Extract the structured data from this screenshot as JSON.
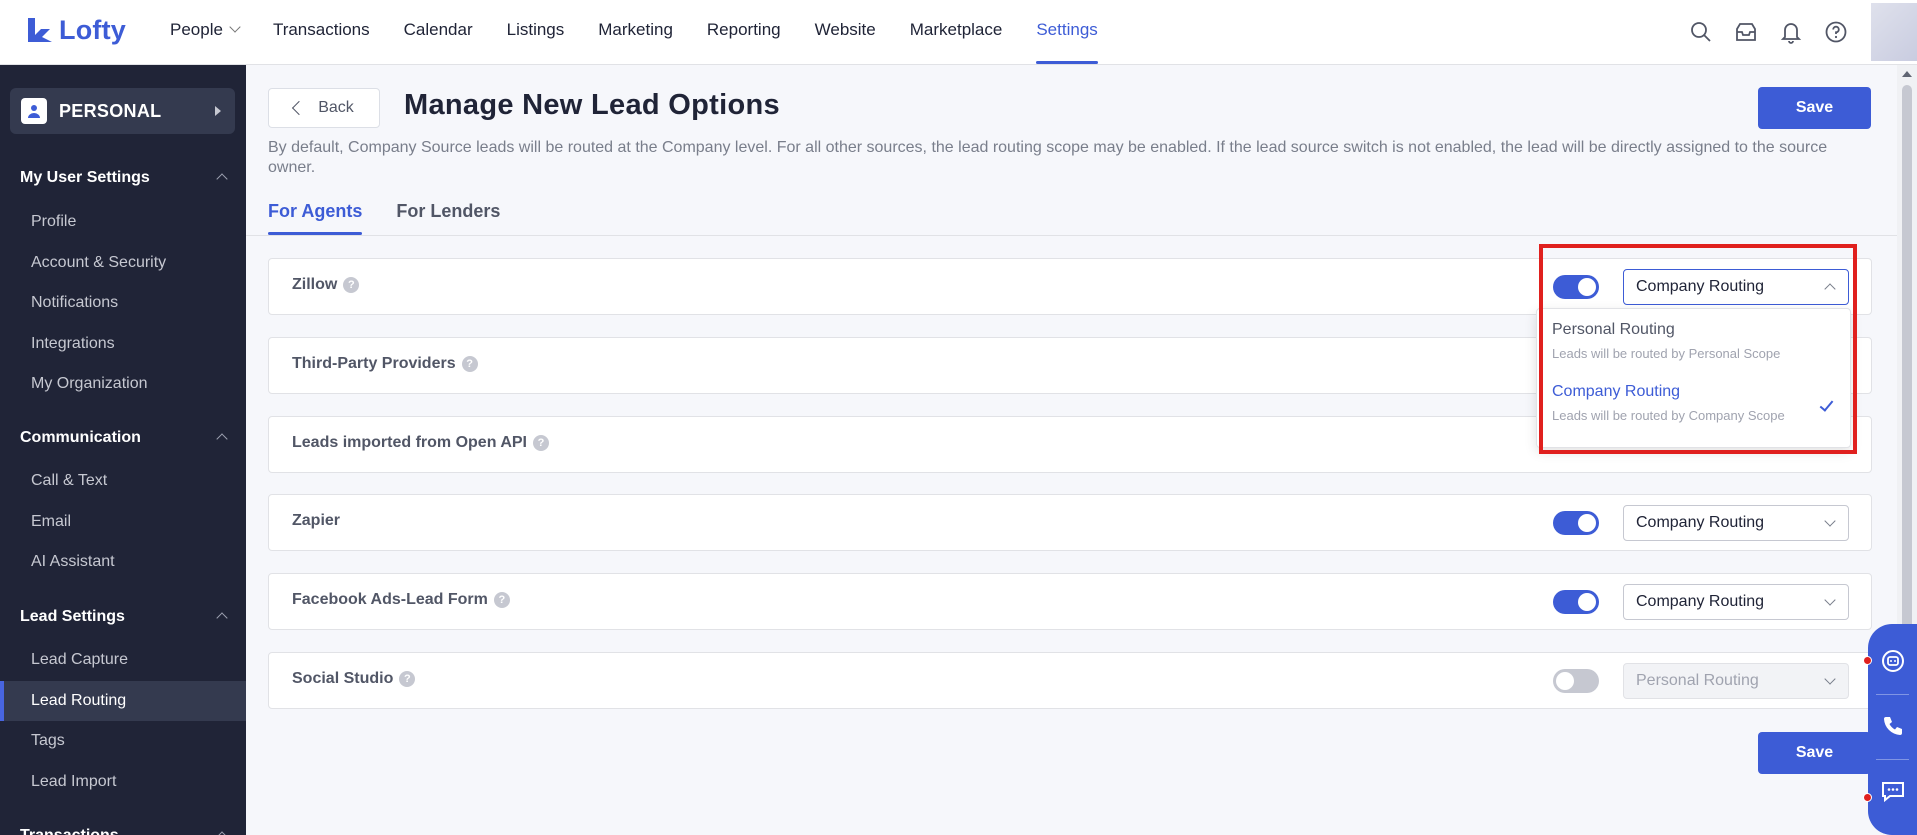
{
  "brand": {
    "name": "Lofty",
    "color": "#3d5cd6"
  },
  "nav": {
    "items": [
      {
        "label": "People",
        "has_chevron": true
      },
      {
        "label": "Transactions"
      },
      {
        "label": "Calendar"
      },
      {
        "label": "Listings"
      },
      {
        "label": "Marketing"
      },
      {
        "label": "Reporting"
      },
      {
        "label": "Website"
      },
      {
        "label": "Marketplace"
      },
      {
        "label": "Settings",
        "active": true
      }
    ],
    "icons": [
      "search-icon",
      "inbox-icon",
      "bell-icon",
      "help-circle-icon"
    ]
  },
  "sidebar": {
    "account_label": "PERSONAL",
    "sections": [
      {
        "title": "My User Settings",
        "items": [
          "Profile",
          "Account & Security",
          "Notifications",
          "Integrations",
          "My Organization"
        ]
      },
      {
        "title": "Communication",
        "items": [
          "Call & Text",
          "Email",
          "AI Assistant"
        ]
      },
      {
        "title": "Lead Settings",
        "items": [
          "Lead Capture",
          "Lead Routing",
          "Tags",
          "Lead Import"
        ],
        "active_item": "Lead Routing"
      },
      {
        "title": "Transactions",
        "items": []
      }
    ]
  },
  "page": {
    "back_label": "Back",
    "title": "Manage New Lead Options",
    "save_label": "Save",
    "description": "By default, Company Source leads will be routed at the Company level. For all other sources, the lead routing scope may be enabled. If the lead source switch is not enabled, the lead will be directly assigned to the source owner.",
    "tabs": [
      {
        "label": "For Agents",
        "active": true
      },
      {
        "label": "For Lenders"
      }
    ]
  },
  "sources": [
    {
      "name": "Zillow",
      "help": true,
      "enabled": true,
      "routing": "Company Routing",
      "dropdown_open": true
    },
    {
      "name": "Third-Party Providers",
      "help": true
    },
    {
      "name": "Leads imported from Open API",
      "help": true
    },
    {
      "name": "Zapier",
      "help": false,
      "enabled": true,
      "routing": "Company Routing"
    },
    {
      "name": "Facebook Ads-Lead Form",
      "help": true,
      "enabled": true,
      "routing": "Company Routing"
    },
    {
      "name": "Social Studio",
      "help": true,
      "enabled": false,
      "routing": "Personal Routing"
    }
  ],
  "dropdown": {
    "options": [
      {
        "title": "Personal Routing",
        "subtitle": "Leads will be routed by Personal Scope",
        "selected": false
      },
      {
        "title": "Company Routing",
        "subtitle": "Leads will be routed by Company Scope",
        "selected": true
      }
    ]
  },
  "help_glyph": "?",
  "float_widget": {
    "icons": [
      "chat-bot-icon",
      "phone-icon",
      "message-icon"
    ]
  }
}
